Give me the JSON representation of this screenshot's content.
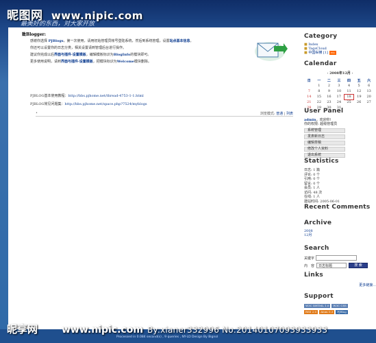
{
  "watermark": {
    "top_logo": "昵图网",
    "top_url": "www.nipic.com",
    "bottom_logo": "昵享网",
    "bottom_url": "www.nipic.com",
    "bottom_id": "By:xianer332996 No:20140107093933933"
  },
  "header": {
    "subtitle": "最美好的东西，对大家开放"
  },
  "post": {
    "title": "致Blogger:",
    "p1_a": "感谢你选择",
    "p1_b": "PJBlogs",
    "p1_c": "，第一次使用，请用初始管理员帐号登陆系统，然后到系统管理，设置",
    "p1_d": "站点基本信息",
    "p1_e": "。",
    "p2": "你还可以设置你的日志分类，相关设置请到管理后台进行操作。",
    "p3_a": "建议你完成以后",
    "p3_b": "界面与插件·设置模板",
    "p3_c": "，编辑模板标识为",
    "p3_d": "BlogInfo",
    "p3_e": "的模块即可。",
    "p4_a": "更多使用说明，请到",
    "p4_b": "界面与插件·设置模板",
    "p4_c": "，把模块标识为",
    "p4_d": "Welcome",
    "p4_e": "模块删除。",
    "link1_label": "PJBLOG基本使用教程：",
    "link1_url": "http://bbs.pjhome.net/thread-4753-1-1.html",
    "link2_label": "PJBLOG常见问题集：",
    "link2_url": "http://bbs.pjhome.net/space.php?7524/myblogs",
    "foot_left": "•",
    "foot_right_label": "浏览模式:",
    "foot_normal": "普通",
    "foot_list": "列表"
  },
  "sidebar": {
    "category": {
      "title": "Category",
      "items": [
        "Index",
        "TagsCloud",
        "中国纵横 [1]"
      ]
    },
    "calendar": {
      "title": "Calendar",
      "month": "2008年12月",
      "weekdays": [
        "日",
        "一",
        "二",
        "三",
        "四",
        "五",
        "六"
      ],
      "rows": [
        [
          "",
          "1",
          "2",
          "3",
          "4",
          "5",
          "6"
        ],
        [
          "7",
          "8",
          "9",
          "10",
          "11",
          "12",
          "13"
        ],
        [
          "14",
          "15",
          "16",
          "17",
          "18",
          "19",
          "20"
        ],
        [
          "21",
          "22",
          "23",
          "24",
          "25",
          "26",
          "27"
        ],
        [
          "28",
          "29",
          "30",
          "31",
          "",
          "",
          ""
        ]
      ]
    },
    "user_panel": {
      "title": "User Panel",
      "greeting_name": "admin",
      "greeting_text": "，欢迎你!",
      "role_text": "你的权限: 超级管理员",
      "buttons": [
        "系统管理",
        "发表新日志",
        "编辑草稿",
        "修改个人资料",
        "退出系统"
      ]
    },
    "statistics": {
      "title": "Statistics",
      "items": [
        "日志: 1 篇",
        "评论: 0 个",
        "引用: 0 个",
        "留言: 0 个",
        "会员: 1 人",
        "访问: 48 次",
        "在线: 1 人",
        "建站时间: 2005-06-01"
      ]
    },
    "recent_comments": {
      "title": "Recent Comments"
    },
    "archive": {
      "title": "Archive",
      "items": [
        "2008",
        "12月"
      ]
    },
    "search": {
      "title": "Search",
      "keyword_label": "关键字",
      "scope_label": "内　容",
      "select_value": "日志标题",
      "button": "搜 索"
    },
    "links": {
      "title": "Links",
      "more": "更多链接..."
    },
    "support": {
      "title": "Support",
      "badges": [
        "W3C XHTML 1.0",
        "W3C CSS",
        "RSS 2.0",
        "Atom 0.3",
        "PJBlog"
      ]
    }
  },
  "footer": {
    "text": "Processed in 0.084 second(s) , 9 queries    ,  NY-LD Design By Bignol"
  },
  "colors": {
    "link": "#0a3a8f",
    "header_top": "#0f2d67",
    "header_bottom": "#3a70ad",
    "button_dark": "#2b3f8a"
  }
}
